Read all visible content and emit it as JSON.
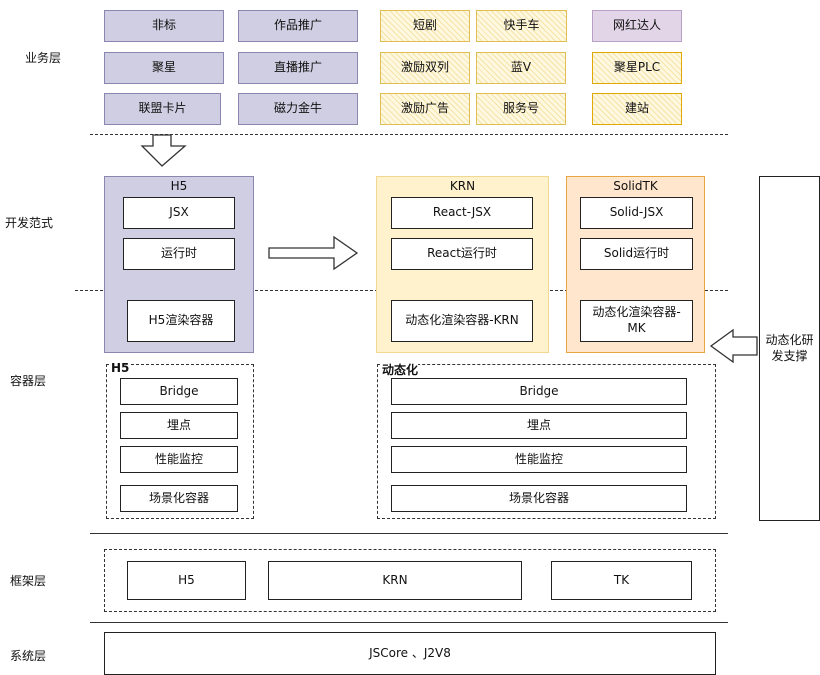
{
  "layers": {
    "business": "业务层",
    "dev": "开发范式",
    "container": "容器层",
    "framework": "框架层",
    "system": "系统层"
  },
  "business": {
    "purple": [
      "非标",
      "作品推广",
      "聚星",
      "直播推广",
      "联盟卡片",
      "磁力金牛"
    ],
    "yellow": [
      "短剧",
      "快手车",
      "激励双列",
      "蓝V",
      "激励广告",
      "服务号"
    ],
    "right": [
      "网红达人",
      "聚星PLC",
      "建站"
    ]
  },
  "dev": {
    "h5": {
      "title": "H5",
      "items": [
        "JSX",
        "运行时",
        "H5渲染容器"
      ]
    },
    "krn": {
      "title": "KRN",
      "items": [
        "React-JSX",
        "React运行时",
        "动态化渲染容器-KRN"
      ]
    },
    "solid": {
      "title": "SolidTK",
      "items": [
        "Solid-JSX",
        "Solid运行时",
        "动态化渲染容器-MK"
      ]
    },
    "support": "动态化研发支撑"
  },
  "container": {
    "h5": {
      "title": "H5",
      "items": [
        "Bridge",
        "埋点",
        "性能监控",
        "场景化容器"
      ]
    },
    "dyn": {
      "title": "动态化",
      "items": [
        "Bridge",
        "埋点",
        "性能监控",
        "场景化容器"
      ]
    }
  },
  "framework": [
    "H5",
    "KRN",
    "TK"
  ],
  "system": "JSCore 、J2V8",
  "colors": {
    "purple": "#d0cee2",
    "yellow": "#fff2cc",
    "orange": "#ffe6cc"
  }
}
